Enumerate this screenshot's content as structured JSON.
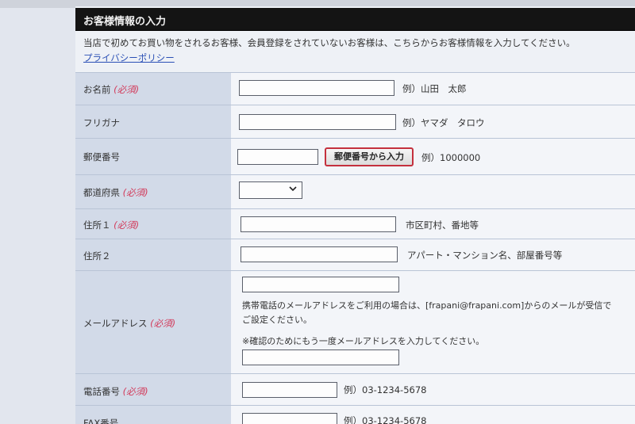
{
  "header": {
    "title": "お客様情報の入力"
  },
  "intro": {
    "text": "当店で初めてお買い物をされるお客様、会員登録をされていないお客様は、こちらからお客様情報を入力してください。",
    "privacy_link": "プライバシーポリシー"
  },
  "rows": {
    "name": {
      "label": "お名前",
      "required": "(必須)",
      "hint": "例）山田　太郎"
    },
    "kana": {
      "label": "フリガナ",
      "hint": "例）ヤマダ　タロウ"
    },
    "postal": {
      "label": "郵便番号",
      "button": "郵便番号から入力",
      "hint": "例）1000000"
    },
    "prefecture": {
      "label": "都道府県",
      "required": "(必須)"
    },
    "address1": {
      "label": "住所１",
      "required": "(必須)",
      "hint": "市区町村、番地等"
    },
    "address2": {
      "label": "住所２",
      "hint": "アパート・マンション名、部屋番号等"
    },
    "email": {
      "label": "メールアドレス",
      "required": "(必須)",
      "note1": "携帯電話のメールアドレスをご利用の場合は、[frapani@frapani.com]からのメールが受信で",
      "note2": "ご設定ください。",
      "confirm_note": "※確認のためにもう一度メールアドレスを入力してください。"
    },
    "phone": {
      "label": "電話番号",
      "required": "(必須)",
      "hint": "例）03-1234-5678"
    },
    "fax": {
      "label": "FAX番号",
      "hint": "例）03-1234-5678"
    }
  }
}
